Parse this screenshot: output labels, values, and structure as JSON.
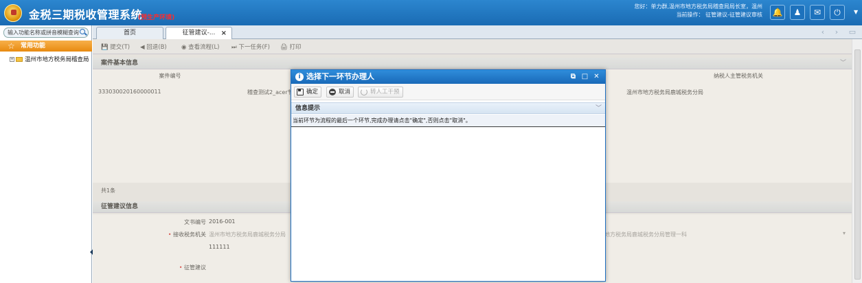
{
  "header": {
    "title": "金税三期税收管理系统",
    "env_tag": "(预生产环境)",
    "user_line1": "您好：单力群,温州市地方税务局稽查局局长室，温州",
    "user_line2": "当前操作： 征管建议-征管建议审核",
    "icons": [
      "bell-icon",
      "users-icon",
      "chat-icon",
      "power-icon"
    ]
  },
  "sidebar": {
    "search_placeholder": "输入功能名称或拼音模糊查询",
    "favorites_label": "常用功能",
    "tree_item": "温州市地方税务局稽查局"
  },
  "tabs": [
    {
      "label": "首页"
    },
    {
      "label": "征管建议-..."
    }
  ],
  "toolbar": {
    "submit": "提交(T)",
    "back": "回退(B)",
    "view_flow": "查看流程(L)",
    "next_task": "下一任务(F)",
    "print": "打印"
  },
  "case_section": {
    "title": "案件基本信息",
    "headers": [
      "案件编号",
      "纳税人主管税务机关"
    ],
    "row": {
      "case_no": "333030020160000011",
      "name": "稽查测试2_acer节",
      "authority": "温州市地方税务局鹿城税务分局"
    },
    "record_count": "共1条"
  },
  "proposal_section": {
    "title": "征管建议信息",
    "doc_no_label": "文书编号",
    "doc_no_value": "2016-001",
    "authority_label": "接收税务机关",
    "authority_value_left": "温州市地方税务局鹿城税务分局",
    "authority_value_right": "地方税务局鹿城税务分局管理一科",
    "suggestion_label": "征管建议",
    "suggestion_value": "111111"
  },
  "dialog": {
    "title": "选择下一环节办理人",
    "confirm": "确定",
    "cancel": "取消",
    "transfer": "转人工干预",
    "info_title": "信息提示",
    "message": "当前环节为流程的最后一个环节,完成办理请点击\"确定\",否则点击\"取消\"。"
  }
}
